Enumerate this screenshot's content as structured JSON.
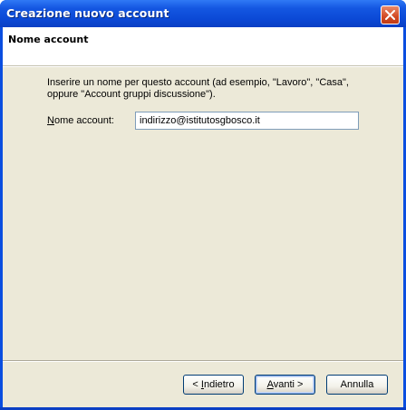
{
  "window": {
    "title": "Creazione nuovo account",
    "close_icon": "close-icon"
  },
  "header": {
    "title": "Nome account"
  },
  "content": {
    "instructions_line1": "Inserire un nome per questo account (ad esempio, \"Lavoro\", \"Casa\",",
    "instructions_line2": "oppure \"Account gruppi discussione\").",
    "account_label_accel": "N",
    "account_label_rest": "ome account:",
    "account_value": "indirizzo@istitutosgbosco.it"
  },
  "buttons": {
    "back_prefix": "< ",
    "back_accel": "I",
    "back_rest": "ndietro",
    "next_accel": "A",
    "next_rest": "vanti >",
    "cancel": "Annulla"
  }
}
